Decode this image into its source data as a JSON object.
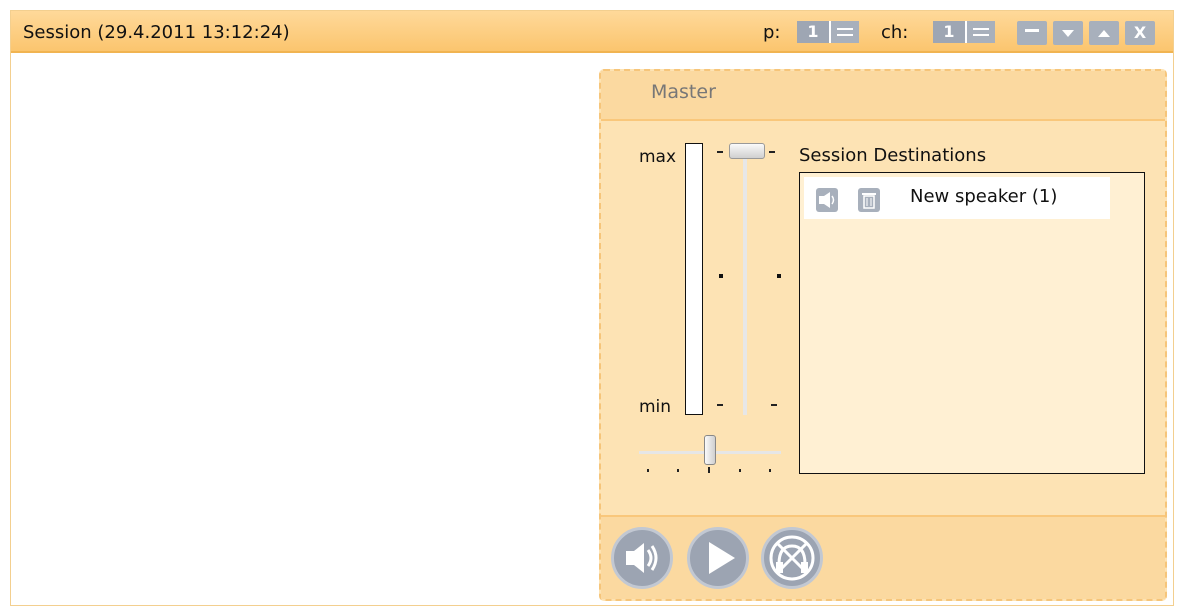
{
  "window": {
    "title": "Session (29.4.2011 13:12:24)",
    "page_label": "p:",
    "page_value": "1",
    "channel_label": "ch:",
    "channel_value": "1",
    "buttons": {
      "minimize": "minimize-icon",
      "down": "arrow-down-icon",
      "up": "arrow-up-icon",
      "close": "X"
    }
  },
  "master": {
    "title": "Master",
    "meter": {
      "max_label": "max",
      "min_label": "min"
    },
    "volume_level": 1.0,
    "balance_level": 0.5,
    "destinations": {
      "label": "Session Destinations",
      "items": [
        {
          "name": "New speaker (1)",
          "icons": [
            "speaker-icon",
            "trash-icon"
          ]
        }
      ]
    },
    "controls": [
      "speaker-icon",
      "play-icon",
      "headphones-icon"
    ]
  },
  "colors": {
    "accent": "#fbc56e",
    "panel": "#fde3b4",
    "button": "#9ea6b3"
  }
}
